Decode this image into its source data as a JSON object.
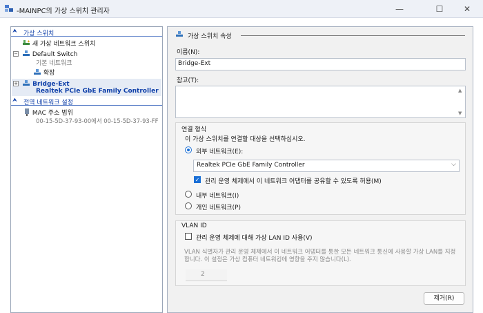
{
  "window": {
    "title_host": "MAINPC",
    "title": "-MAINPC의 가상 스위치 관리자",
    "minimize_glyph": "—",
    "maximize_glyph": "☐",
    "close_glyph": "✕"
  },
  "sidebar": {
    "virtual_switches_header": "가상 스위치",
    "new_switch": "새 가상 네트워크 스위치",
    "default_switch": {
      "name": "Default Switch",
      "subtitle": "기본 네트워크",
      "child": "확장"
    },
    "bridge": {
      "name": "Bridge-Ext",
      "adapter": "Realtek PCIe GbE Family Controller"
    },
    "global_header": "전역 네트워크 설정",
    "mac": {
      "name": "MAC 주소 범위",
      "range": "00-15-5D-37-93-00에서 00-15-5D-37-93-FF"
    }
  },
  "props": {
    "section_title": "가상 스위치 속성",
    "name_label": "이름(N):",
    "name_value": "Bridge-Ext",
    "notes_label": "참고(T):",
    "notes_value": "",
    "conn_type": {
      "title": "연결 형식",
      "prompt": "이 가상 스위치를 연결할 대상을 선택하십시오.",
      "external_label": "외부 네트워크(E):",
      "adapter_selected": "Realtek PCIe GbE Family Controller",
      "allow_mgmt_label": "관리 운영 체제에서 이 네트워크 어댑터를 공유할 수 있도록 허용(M)",
      "allow_mgmt_checked": true,
      "internal_label": "내부 네트워크(I)",
      "private_label": "개인 네트워크(P)",
      "selected": "external"
    },
    "vlan": {
      "title": "VLAN ID",
      "enable_label": "관리 운영 체제에 대해 가상 LAN ID 사용(V)",
      "enable_checked": false,
      "description": "VLAN 식별자가 관리 운영 체제에서 이 네트워크 어댑터를 통한 모든 네트워크 통신에 사용할 가상 LAN를 지정합니다. 이 설정은 가상 컴퓨터 네트워킹에 영향을 주지 않습니다(L).",
      "id_value": "2"
    },
    "remove_button": "제거(R)"
  }
}
